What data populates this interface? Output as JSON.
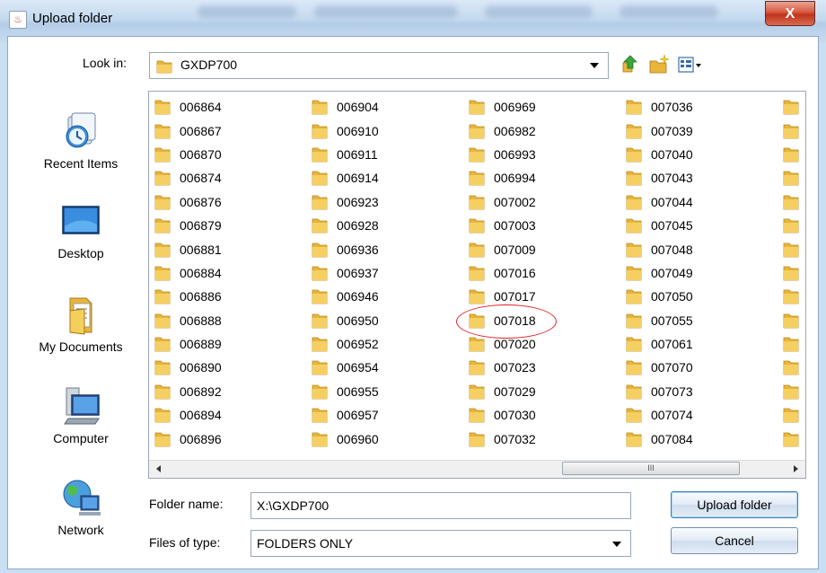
{
  "window": {
    "title": "Upload folder",
    "close_label": "X"
  },
  "look_in": {
    "label": "Look in:",
    "value": "GXDP700"
  },
  "toolbar": {
    "icons": [
      "up-one-level-icon",
      "create-new-folder-icon",
      "view-menu-icon"
    ]
  },
  "places": [
    {
      "label": "Recent Items",
      "icon": "recent-items-icon"
    },
    {
      "label": "Desktop",
      "icon": "desktop-icon"
    },
    {
      "label": "My Documents",
      "icon": "my-documents-icon"
    },
    {
      "label": "Computer",
      "icon": "computer-icon"
    },
    {
      "label": "Network",
      "icon": "network-icon"
    }
  ],
  "folders": {
    "columns": [
      [
        "006864",
        "006867",
        "006870",
        "006874",
        "006876",
        "006879",
        "006881",
        "006884",
        "006886",
        "006888",
        "006889",
        "006890",
        "006892",
        "006894",
        "006896"
      ],
      [
        "006904",
        "006910",
        "006911",
        "006914",
        "006923",
        "006928",
        "006936",
        "006937",
        "006946",
        "006950",
        "006952",
        "006954",
        "006955",
        "006957",
        "006960"
      ],
      [
        "006969",
        "006982",
        "006993",
        "006994",
        "007002",
        "007003",
        "007009",
        "007016",
        "007017",
        "007018",
        "007020",
        "007023",
        "007029",
        "007030",
        "007032"
      ],
      [
        "007036",
        "007039",
        "007040",
        "007043",
        "007044",
        "007045",
        "007048",
        "007049",
        "007050",
        "007055",
        "007061",
        "007070",
        "007073",
        "007074",
        "007084"
      ]
    ],
    "highlighted": "007018"
  },
  "scrollbar": {
    "thumb_grip": "III"
  },
  "folder_name": {
    "label": "Folder name:",
    "value": "X:\\GXDP700"
  },
  "file_type": {
    "label": "Files of type:",
    "value": "FOLDERS ONLY"
  },
  "buttons": {
    "upload": "Upload folder",
    "cancel": "Cancel"
  },
  "colors": {
    "folder": "#e8b53a",
    "highlight": "#e0222b"
  }
}
